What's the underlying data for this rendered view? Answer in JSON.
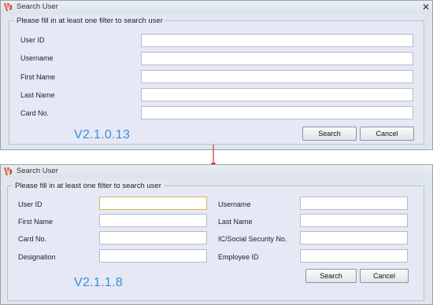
{
  "window1": {
    "title": "Search User",
    "legend": "Please fill in at least one filter to search user",
    "fields": [
      {
        "label": "User ID",
        "value": ""
      },
      {
        "label": "Username",
        "value": ""
      },
      {
        "label": "First Name",
        "value": ""
      },
      {
        "label": "Last Name",
        "value": ""
      },
      {
        "label": "Card No.",
        "value": ""
      }
    ],
    "search_label": "Search",
    "cancel_label": "Cancel",
    "version": "V2.1.0.13"
  },
  "window2": {
    "title": "Search User",
    "legend": "Please fill in at least one filter to search user",
    "left_fields": [
      {
        "label": "User ID",
        "value": ""
      },
      {
        "label": "First Name",
        "value": ""
      },
      {
        "label": "Card No.",
        "value": ""
      },
      {
        "label": "Designation",
        "value": ""
      }
    ],
    "right_fields": [
      {
        "label": "Username",
        "value": ""
      },
      {
        "label": "Last Name",
        "value": ""
      },
      {
        "label": "IC/Social Security No.",
        "value": ""
      },
      {
        "label": "Employee ID",
        "value": ""
      }
    ],
    "search_label": "Search",
    "cancel_label": "Cancel",
    "version": "V2.1.1.8"
  },
  "icons": {
    "app_logo": "app-logo-icon",
    "close": "close-icon",
    "arrow": "arrow-down-icon",
    "grip": "resize-grip-icon"
  },
  "colors": {
    "version_text": "#3b8fd4",
    "arrow": "#d9302b",
    "logo": "#e0542a"
  }
}
